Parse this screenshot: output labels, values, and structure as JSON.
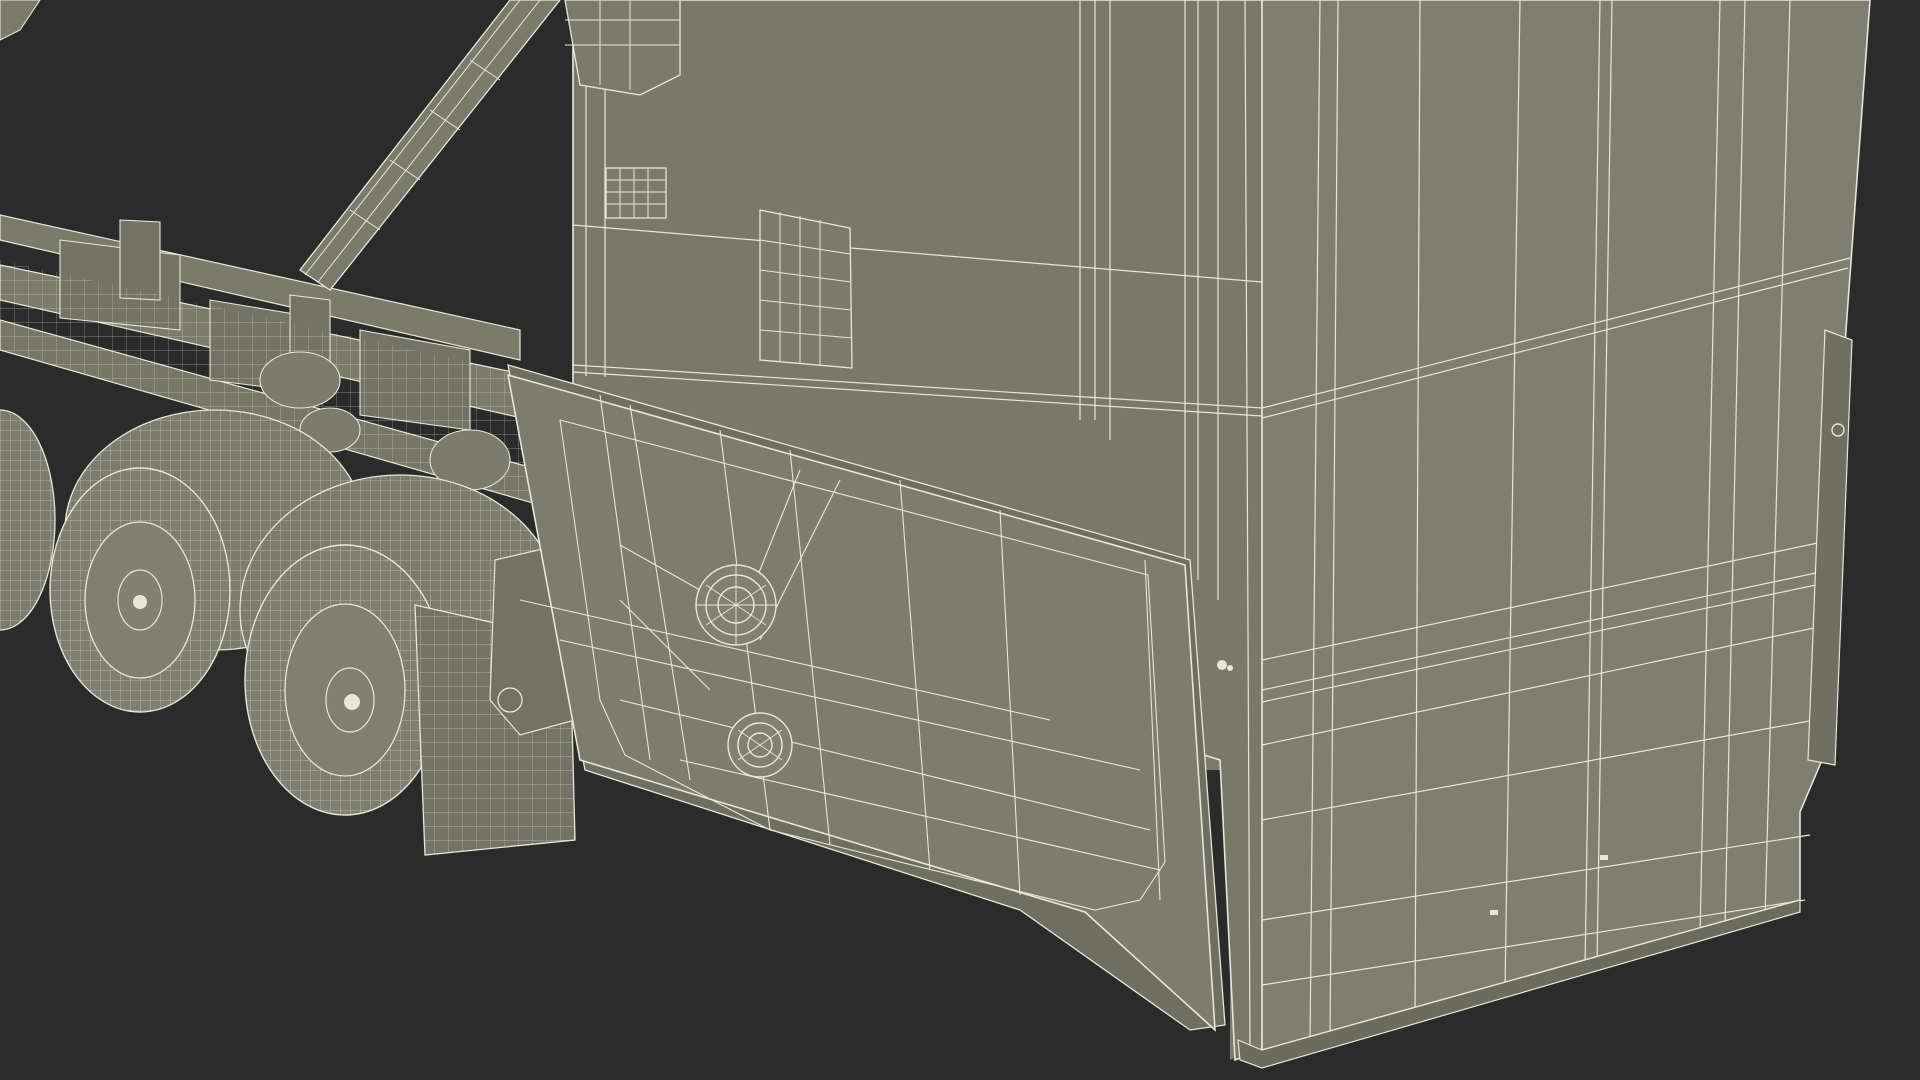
{
  "scene": {
    "subject": "truck-rear-wireframe-render",
    "colors": {
      "background": "#2b2b2b",
      "surface": "#7a7b6b",
      "surface_dark": "#6b6c5d",
      "surface_light": "#85867a",
      "wire": "#e8e6d6",
      "wire_dim": "#c9c7b5",
      "shadow": "#1f1f1f"
    }
  }
}
